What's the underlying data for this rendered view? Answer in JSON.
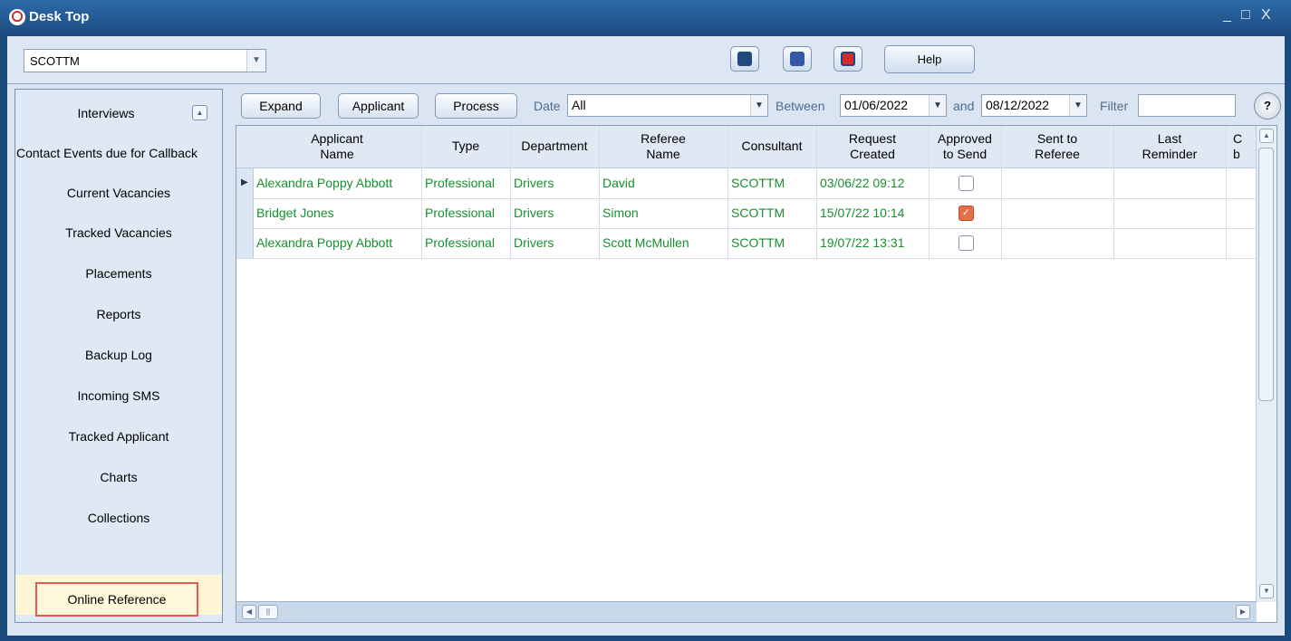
{
  "window": {
    "title": "Desk Top",
    "controls": [
      "_",
      "□",
      "X"
    ]
  },
  "user_selector": {
    "value": "SCOTTM"
  },
  "toolbar": {
    "help_label": "Help"
  },
  "sidebar": {
    "items": [
      "Interviews",
      "Contact Events due for Callback",
      "Current Vacancies",
      "Tracked Vacancies",
      "Placements",
      "Reports",
      "Backup Log",
      "Incoming SMS",
      "Tracked Applicant",
      "Charts",
      "Collections",
      "Online Reference"
    ]
  },
  "filters": {
    "expand_label": "Expand",
    "applicant_label": "Applicant",
    "process_label": "Process",
    "date_label": "Date",
    "date_value": "All",
    "between_label": "Between",
    "start_date": "01/06/2022",
    "and_label": "and",
    "end_date": "08/12/2022",
    "filter_label": "Filter",
    "filter_value": "",
    "help_symbol": "?"
  },
  "table": {
    "headers": [
      "Applicant\nName",
      "Type",
      "Department",
      "Referee\nName",
      "Consultant",
      "Request\nCreated",
      "Approved\nto Send",
      "Sent to\nReferee",
      "Last\nReminder",
      "C\nb"
    ],
    "rows": [
      {
        "applicant": "Alexandra Poppy Abbott",
        "type": "Professional",
        "department": "Drivers",
        "referee": "David",
        "consultant": "SCOTTM",
        "created": "03/06/22 09:12",
        "approved": false
      },
      {
        "applicant": "Bridget Jones",
        "type": "Professional",
        "department": "Drivers",
        "referee": "Simon",
        "consultant": "SCOTTM",
        "created": "15/07/22 10:14",
        "approved": true
      },
      {
        "applicant": "Alexandra Poppy Abbott",
        "type": "Professional",
        "department": "Drivers",
        "referee": "Scott McMullen",
        "consultant": "SCOTTM",
        "created": "19/07/22 13:31",
        "approved": false
      }
    ]
  },
  "colors": {
    "text_green": "#16902f",
    "highlight_outline": "#e25b57",
    "titlebar": "#1c4b80"
  }
}
